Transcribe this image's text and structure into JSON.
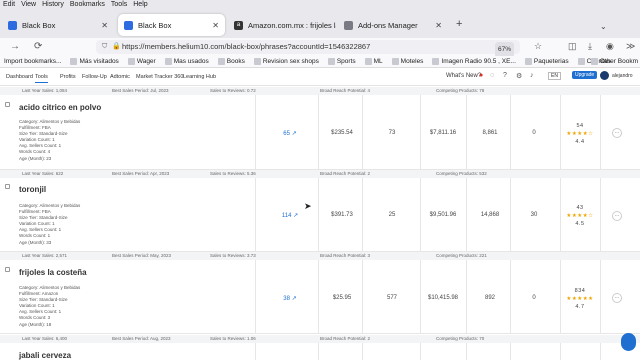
{
  "menu": [
    "Edit",
    "View",
    "History",
    "Bookmarks",
    "Tools",
    "Help"
  ],
  "tabs": [
    {
      "title": "Black Box",
      "color": "#2d6be0",
      "active": false
    },
    {
      "title": "Black Box",
      "color": "#2d6be0",
      "active": true
    },
    {
      "title": "Amazon.com.mx : frijoles la cost",
      "color": "#333",
      "active": false
    },
    {
      "title": "Add-ons Manager",
      "color": "#7a7a85",
      "active": false
    }
  ],
  "new_tab": "+",
  "url": "https://members.helium10.com/black-box/phrases?accountId=1546322867",
  "zoom": "67%",
  "bookmarks": [
    "Import bookmarks...",
    "Más visitados",
    "Wager",
    "Mas usados",
    "Books",
    "Revision sex shops",
    "Sports",
    "ML",
    "Moteles",
    "Imagen Radio 90.5 , XE...",
    "Paqueterias",
    "Cuentas"
  ],
  "other_bookmarks": "Other Bookm",
  "helium_nav": {
    "items": [
      "Dashboard",
      "Tools",
      "Profits",
      "Follow-Up",
      "Adtomic",
      "Market Tracker 360",
      "Learning Hub"
    ],
    "whats_new": "What's New?",
    "badge": "●",
    "lang": "EN",
    "upgrade": "Upgrade",
    "user": "alejandro"
  },
  "summaries": [
    {
      "last_year": "Last Year Sales: 1,084",
      "best": "Best Sales Period: Jul, 2023",
      "ratio": "Sales to Reviews: 0.72",
      "broad": "Broad Reach Potential: 4",
      "competing": "Competing Products: 78"
    },
    {
      "last_year": "Last Year Sales: 622",
      "best": "Best Sales Period: Apr, 2023",
      "ratio": "Sales to Reviews: 5.36",
      "broad": "Broad Reach Potential: 2",
      "competing": "Competing Products: 532"
    },
    {
      "last_year": "Last Year Sales: 2,571",
      "best": "Best Sales Period: May, 2023",
      "ratio": "Sales to Reviews: 3.73",
      "broad": "Broad Reach Potential: 3",
      "competing": "Competing Products: 221"
    },
    {
      "last_year": "Last Year Sales: 6,400",
      "best": "Best Sales Period: Aug, 2023",
      "ratio": "Sales to Reviews: 1.06",
      "broad": "Broad Reach Potential: 2",
      "competing": "Competing Products: 70"
    }
  ],
  "products": [
    {
      "name": "acido citrico en polvo",
      "category": "Category: Alimentos y Bebidas",
      "fulfillment": "Fulfillment: FBA",
      "size": "Size Tier: Standard-Size",
      "variation": "Variation Count: 1",
      "sellers": "Avg. Sellers Count: 1",
      "words": "Words Count: 4",
      "age": "Age (Month): 23",
      "searches": "65",
      "price": "$235.54",
      "reviews": "73",
      "revenue": "$7,811.16",
      "sales": "8,861",
      "zero": "0",
      "stars": "★★★★☆",
      "rating_count": "54",
      "rating": "4.4"
    },
    {
      "name": "toronjil",
      "category": "Category: Alimentos y Bebidas",
      "fulfillment": "Fulfillment: FBA",
      "size": "Size Tier: Standard-Size",
      "variation": "Variation Count: 1",
      "sellers": "Avg. Sellers Count: 1",
      "words": "Words Count: 1",
      "age": "Age (Month): 33",
      "searches": "114",
      "price": "$391.73",
      "reviews": "25",
      "revenue": "$9,501.96",
      "sales": "14,868",
      "zero": "30",
      "stars": "★★★★☆",
      "rating_count": "43",
      "rating": "4.5"
    },
    {
      "name": "frijoles la costeña",
      "category": "Category: Alimentos y Bebidas",
      "fulfillment": "Fulfillment: Amazon",
      "size": "Size Tier: Standard-Size",
      "variation": "Variation Count: 1",
      "sellers": "Avg. Sellers Count: 1",
      "words": "Words Count: 3",
      "age": "Age (Month): 18",
      "searches": "38",
      "price": "$25.95",
      "reviews": "577",
      "revenue": "$10,415.98",
      "sales": "892",
      "zero": "0",
      "stars": "★★★★★",
      "rating_count": "834",
      "rating": "4.7"
    },
    {
      "name": "jabali cerveza"
    }
  ]
}
